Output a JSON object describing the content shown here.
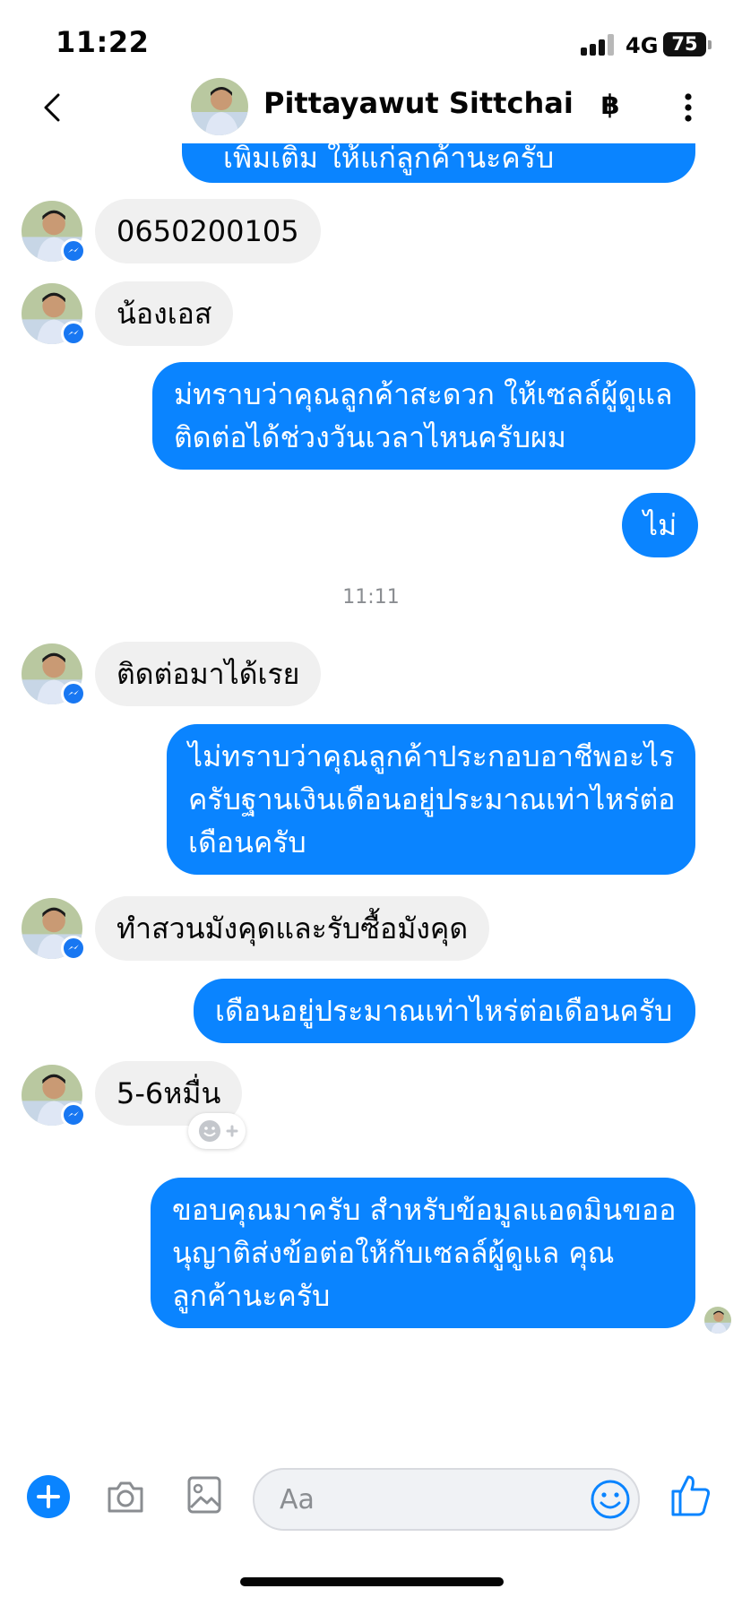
{
  "status_bar": {
    "time": "11:22",
    "network": "4G",
    "battery": "75"
  },
  "header": {
    "contact_name": "Pittayawut Sittchai",
    "payment_symbol": "฿",
    "icons": [
      "back-icon",
      "baht-icon",
      "more-vertical-icon"
    ]
  },
  "messages": [
    {
      "direction": "out",
      "lines": [
        "เพิ่มเติม ให้แก่ลูกค้านะครับ"
      ]
    },
    {
      "direction": "in",
      "text": "0650200105"
    },
    {
      "direction": "in",
      "text": "น้องเอส"
    },
    {
      "direction": "out",
      "lines": [
        "ม่ทราบว่าคุณลูกค้าสะดวก ให้เซลล์ผู้ดูแล",
        "ติดต่อได้ช่วงวันเวลาไหนครับผม"
      ]
    },
    {
      "direction": "out",
      "lines": [
        "ไม่"
      ]
    },
    {
      "direction": "time",
      "text": "11:11"
    },
    {
      "direction": "in",
      "text": "ติดต่อมาได้เรย"
    },
    {
      "direction": "out",
      "lines": [
        "ไม่ทราบว่าคุณลูกค้าประกอบอาชีพอะไร",
        "ครับฐานเงินเดือนอยู่ประมาณเท่าไหร่ต่อ",
        "เดือนครับ"
      ]
    },
    {
      "direction": "in",
      "text": "ทำสวนมังคุดและรับซื้อมังคุด"
    },
    {
      "direction": "out",
      "lines": [
        "เดือนอยู่ประมาณเท่าไหร่ต่อเดือนครับ"
      ]
    },
    {
      "direction": "in",
      "text": "5-6หมื่น"
    },
    {
      "direction": "out",
      "lines": [
        "ขอบคุณมาครับ สำหรับข้อมูลแอดมินขออ",
        "นุญาติส่งข้อต่อให้กับเซลล์ผู้ดูแล คุณ",
        "ลูกค้านะครับ"
      ]
    }
  ],
  "composer": {
    "placeholder": "Aa",
    "value": "",
    "icons": [
      "plus-icon",
      "camera-icon",
      "gallery-icon",
      "emoji-icon",
      "like-icon"
    ]
  },
  "colors": {
    "accent": "#0a84ff",
    "incoming_bubble": "#f0f0f0",
    "messenger_badge": "#1877f2",
    "timestamp": "#8a8d91"
  }
}
